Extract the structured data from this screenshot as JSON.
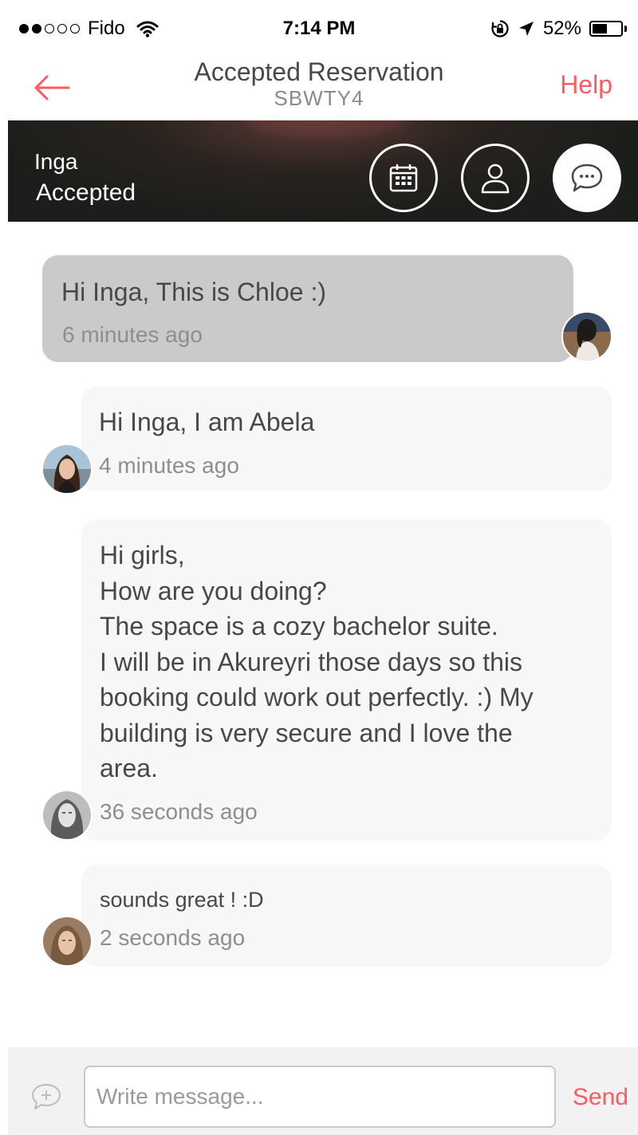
{
  "status_bar": {
    "carrier": "Fido",
    "signal_bars_filled": 2,
    "signal_bars_total": 5,
    "time": "7:14 PM",
    "battery_percent": "52%",
    "battery_level": 0.52
  },
  "nav": {
    "title": "Accepted Reservation",
    "code": "SBWTY4",
    "help_label": "Help",
    "accent_color": "#ff5a5f"
  },
  "banner": {
    "host_name": "Inga",
    "status": "Accepted",
    "actions": [
      "calendar-icon",
      "profile-icon",
      "chat-icon"
    ]
  },
  "messages": [
    {
      "text": "Hi Inga, This is Chloe :)",
      "time": "6 minutes ago",
      "sender_side": "right"
    },
    {
      "text": "Hi Inga, I am Abela",
      "time": "4 minutes ago",
      "sender_side": "left"
    },
    {
      "text": "Hi girls,\nHow are you doing?\nThe space is a cozy bachelor suite.\nI will be in Akureyri those days so this\nbooking could work out perfectly. :) My\nbuilding is very secure and I love the\narea.",
      "time": "36 seconds ago",
      "sender_side": "left"
    },
    {
      "text": "sounds great ! :D",
      "time": "2 seconds ago",
      "sender_side": "left"
    }
  ],
  "composer": {
    "placeholder": "Write message...",
    "send_label": "Send"
  }
}
